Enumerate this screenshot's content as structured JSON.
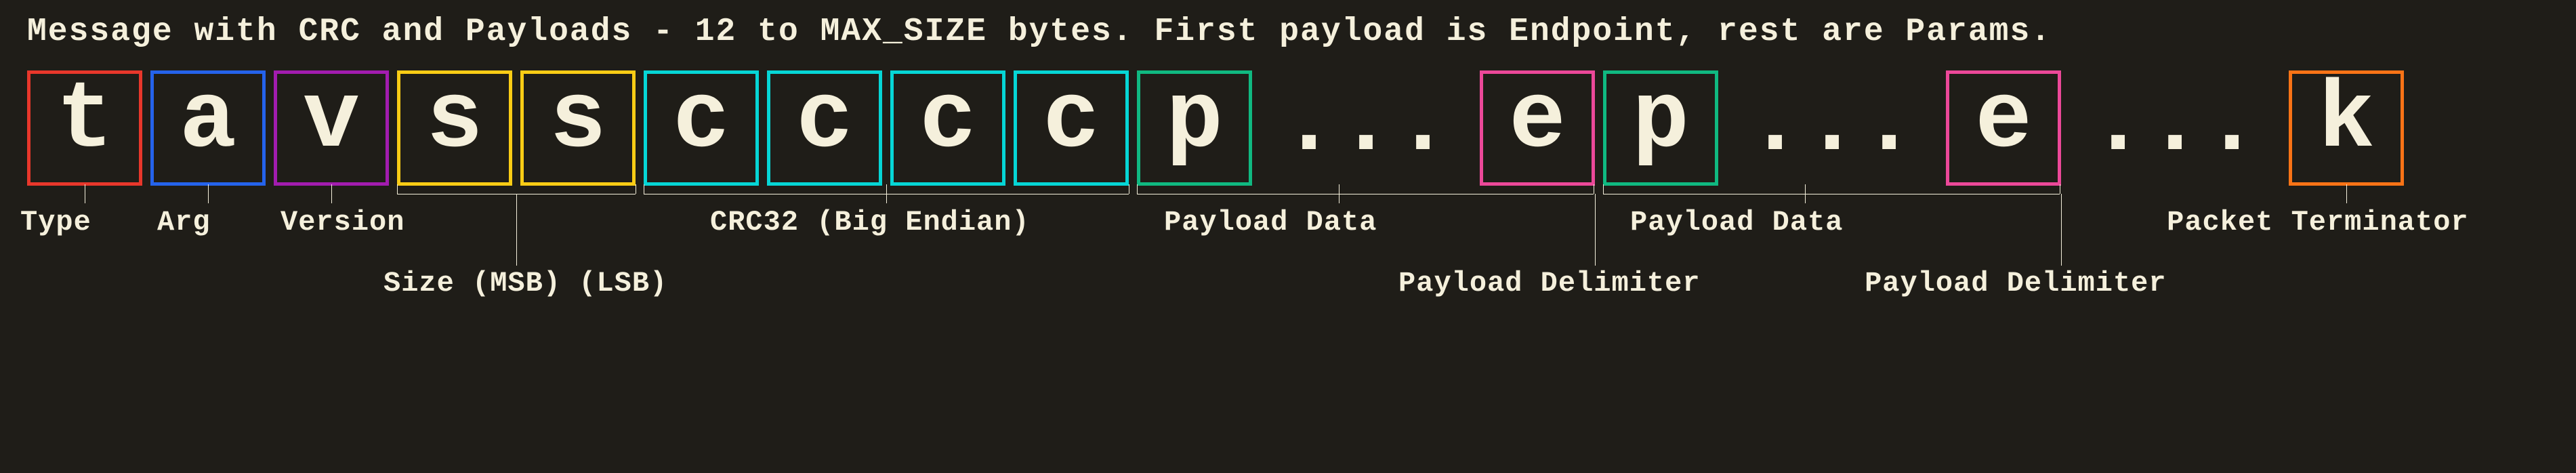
{
  "title": "Message with CRC and Payloads - 12 to MAX_SIZE bytes. First payload is Endpoint, rest are Params.",
  "bytes": {
    "type": "t",
    "arg": "a",
    "version": "v",
    "size_msb": "s",
    "size_lsb": "s",
    "crc0": "c",
    "crc1": "c",
    "crc2": "c",
    "crc3": "c",
    "payload1": "p",
    "payload1_end": "e",
    "payload2": "p",
    "payload2_end": "e",
    "terminator": "k"
  },
  "ellipsis": "...",
  "labels": {
    "type": "Type",
    "arg": "Arg",
    "version": "Version",
    "crc": "CRC32 (Big Endian)",
    "payload_data": "Payload Data",
    "packet_terminator": "Packet Terminator",
    "size": "Size (MSB) (LSB)",
    "payload_delimiter": "Payload Delimiter"
  },
  "colors": {
    "type": "#e8372b",
    "arg": "#2563eb",
    "version": "#a21caf",
    "size": "#facc15",
    "crc": "#06d6d6",
    "payload": "#10b981",
    "payload_end": "#ec4899",
    "terminator": "#f97316"
  }
}
